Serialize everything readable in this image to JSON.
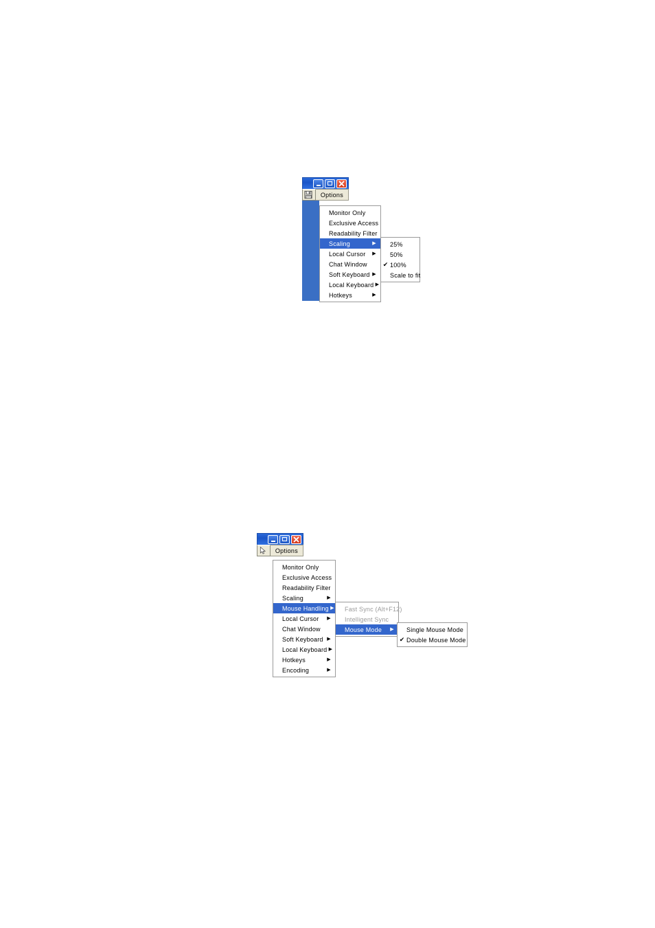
{
  "document": {
    "background_color": "#ffffff"
  },
  "figure1": {
    "name": "scaling-menu-figure",
    "window": {
      "titlebar": {
        "minimize_label": "_",
        "maximize_label": "□",
        "close_label": "✕"
      },
      "toolbar": {
        "icon": "floppy-disk-icon",
        "menu_label": "Options"
      }
    },
    "menu": {
      "items": [
        {
          "label": "Monitor Only",
          "check": "",
          "arrow": "",
          "selected": false,
          "disabled": false
        },
        {
          "label": "Exclusive Access",
          "check": "",
          "arrow": "",
          "selected": false,
          "disabled": false
        },
        {
          "label": "Readability Filter",
          "check": "",
          "arrow": "",
          "selected": false,
          "disabled": false
        },
        {
          "label": "Scaling",
          "check": "",
          "arrow": "▶",
          "selected": true,
          "disabled": false
        },
        {
          "label": "Local Cursor",
          "check": "",
          "arrow": "▶",
          "selected": false,
          "disabled": false
        },
        {
          "label": "Chat Window",
          "check": "",
          "arrow": "",
          "selected": false,
          "disabled": false
        },
        {
          "label": "Soft Keyboard",
          "check": "",
          "arrow": "▶",
          "selected": false,
          "disabled": false
        },
        {
          "label": "Local Keyboard",
          "check": "",
          "arrow": "▶",
          "selected": false,
          "disabled": false
        },
        {
          "label": "Hotkeys",
          "check": "",
          "arrow": "▶",
          "selected": false,
          "disabled": false
        }
      ]
    },
    "submenu": {
      "items": [
        {
          "label": "25%",
          "check": "",
          "arrow": "",
          "selected": false,
          "disabled": false
        },
        {
          "label": "50%",
          "check": "",
          "arrow": "",
          "selected": false,
          "disabled": false
        },
        {
          "label": "100%",
          "check": "✔",
          "arrow": "",
          "selected": false,
          "disabled": false
        },
        {
          "label": "Scale to fit",
          "check": "",
          "arrow": "",
          "selected": false,
          "disabled": false
        }
      ]
    }
  },
  "figure2": {
    "name": "mouse-mode-menu-figure",
    "window": {
      "titlebar": {
        "minimize_label": "_",
        "maximize_label": "□",
        "close_label": "✕"
      },
      "toolbar": {
        "icon": "mouse-cursor-icon",
        "menu_label": "Options"
      }
    },
    "menu": {
      "items": [
        {
          "label": "Monitor Only",
          "check": "",
          "arrow": "",
          "selected": false,
          "disabled": false
        },
        {
          "label": "Exclusive Access",
          "check": "",
          "arrow": "",
          "selected": false,
          "disabled": false
        },
        {
          "label": "Readability Filter",
          "check": "",
          "arrow": "",
          "selected": false,
          "disabled": false
        },
        {
          "label": "Scaling",
          "check": "",
          "arrow": "▶",
          "selected": false,
          "disabled": false
        },
        {
          "label": "Mouse Handling",
          "check": "",
          "arrow": "▶",
          "selected": true,
          "disabled": false
        },
        {
          "label": "Local Cursor",
          "check": "",
          "arrow": "▶",
          "selected": false,
          "disabled": false
        },
        {
          "label": "Chat Window",
          "check": "",
          "arrow": "",
          "selected": false,
          "disabled": false
        },
        {
          "label": "Soft Keyboard",
          "check": "",
          "arrow": "▶",
          "selected": false,
          "disabled": false
        },
        {
          "label": "Local Keyboard",
          "check": "",
          "arrow": "▶",
          "selected": false,
          "disabled": false
        },
        {
          "label": "Hotkeys",
          "check": "",
          "arrow": "▶",
          "selected": false,
          "disabled": false
        },
        {
          "label": "Encoding",
          "check": "",
          "arrow": "▶",
          "selected": false,
          "disabled": false
        }
      ]
    },
    "submenu": {
      "items": [
        {
          "label": "Fast Sync (Alt+F12)",
          "check": "",
          "arrow": "",
          "selected": false,
          "disabled": true
        },
        {
          "label": "Intelligent Sync",
          "check": "",
          "arrow": "",
          "selected": false,
          "disabled": true
        },
        {
          "label": "Mouse Mode",
          "check": "",
          "arrow": "▶",
          "selected": true,
          "disabled": false
        }
      ]
    },
    "subsubmenu": {
      "items": [
        {
          "label": "Single Mouse Mode",
          "check": "",
          "arrow": "",
          "selected": false,
          "disabled": false
        },
        {
          "label": "Double Mouse Mode",
          "check": "✔",
          "arrow": "",
          "selected": false,
          "disabled": false
        }
      ]
    }
  },
  "colors": {
    "menu_highlight": "#3366cc",
    "titlebar_blue": "#1a55c8",
    "close_red": "#d43a1c",
    "toolbar_beige": "#ece9d8",
    "strip_blue": "#3a6fc4",
    "disabled_gray": "#9a9a9a"
  }
}
